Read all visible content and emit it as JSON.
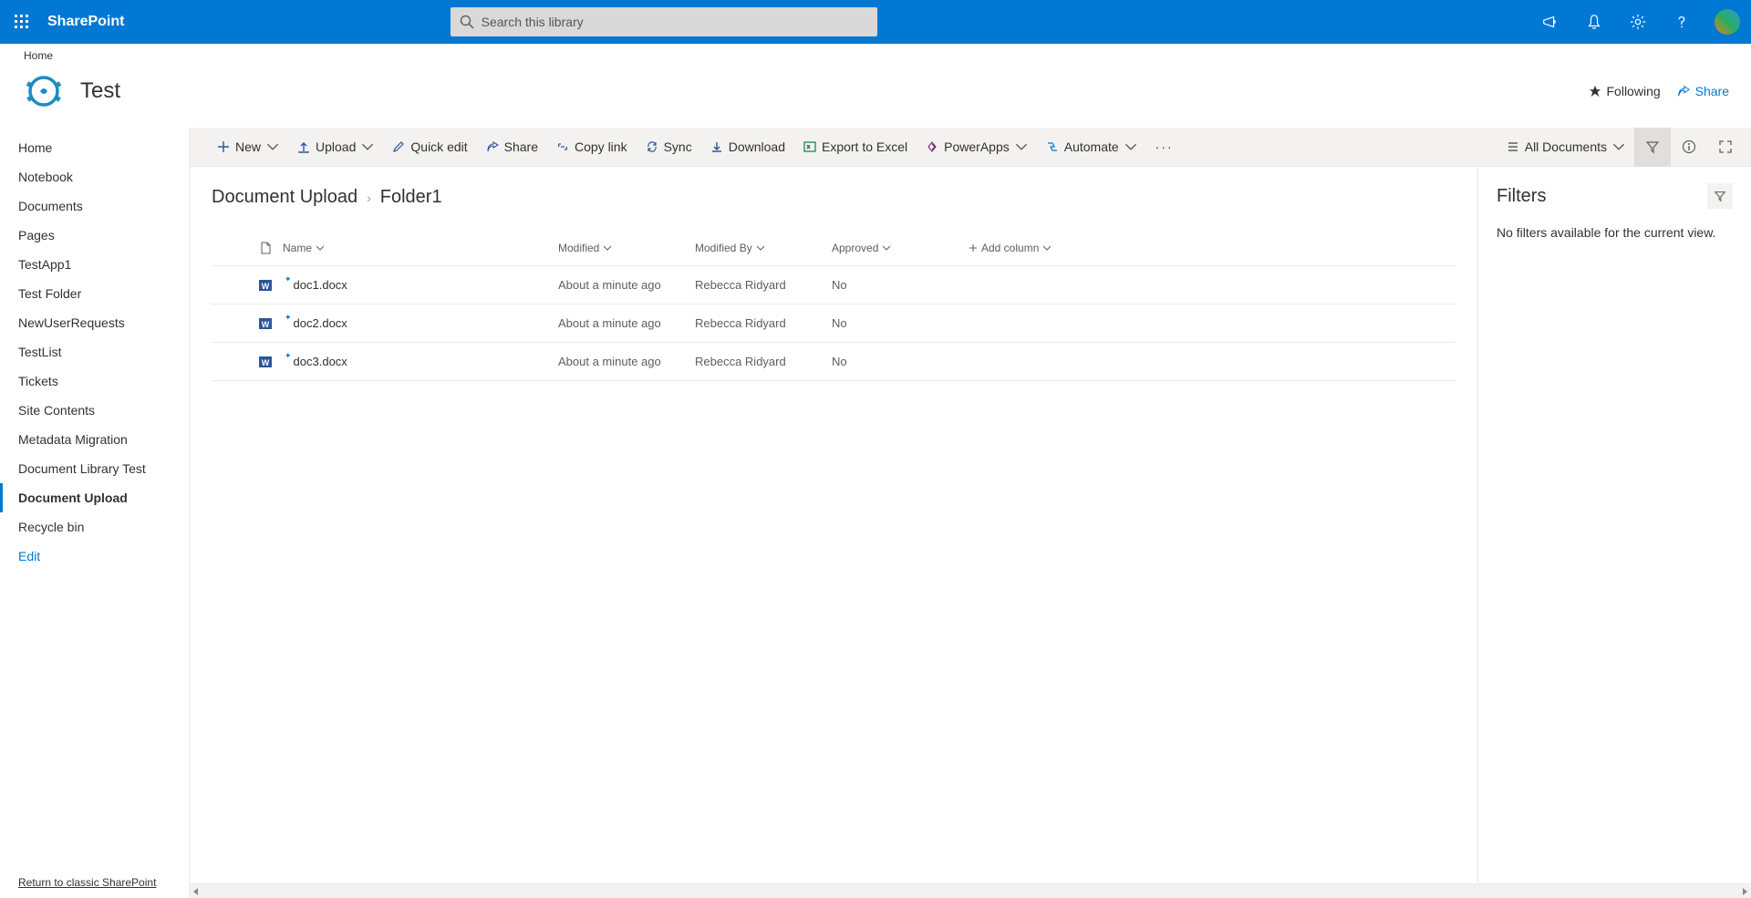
{
  "suite": {
    "appName": "SharePoint",
    "searchPlaceholder": "Search this library"
  },
  "hub": {
    "link": "Home"
  },
  "site": {
    "title": "Test",
    "following": "Following",
    "share": "Share"
  },
  "nav": {
    "items": [
      "Home",
      "Notebook",
      "Documents",
      "Pages",
      "TestApp1",
      "Test Folder",
      "NewUserRequests",
      "TestList",
      "Tickets",
      "Site Contents",
      "Metadata Migration",
      "Document Library Test",
      "Document Upload",
      "Recycle bin"
    ],
    "activeIndex": 12,
    "edit": "Edit",
    "classicLink": "Return to classic SharePoint"
  },
  "commands": {
    "new": "New",
    "upload": "Upload",
    "quickEdit": "Quick edit",
    "share": "Share",
    "copyLink": "Copy link",
    "sync": "Sync",
    "download": "Download",
    "exportExcel": "Export to Excel",
    "powerApps": "PowerApps",
    "automate": "Automate",
    "viewName": "All Documents"
  },
  "breadcrumb": {
    "library": "Document Upload",
    "folder": "Folder1"
  },
  "table": {
    "headers": {
      "name": "Name",
      "modified": "Modified",
      "modifiedBy": "Modified By",
      "approved": "Approved",
      "addColumn": "Add column"
    },
    "rows": [
      {
        "name": "doc1.docx",
        "modified": "About a minute ago",
        "modifiedBy": "Rebecca Ridyard",
        "approved": "No"
      },
      {
        "name": "doc2.docx",
        "modified": "About a minute ago",
        "modifiedBy": "Rebecca Ridyard",
        "approved": "No"
      },
      {
        "name": "doc3.docx",
        "modified": "About a minute ago",
        "modifiedBy": "Rebecca Ridyard",
        "approved": "No"
      }
    ]
  },
  "filters": {
    "title": "Filters",
    "empty": "No filters available for the current view."
  }
}
